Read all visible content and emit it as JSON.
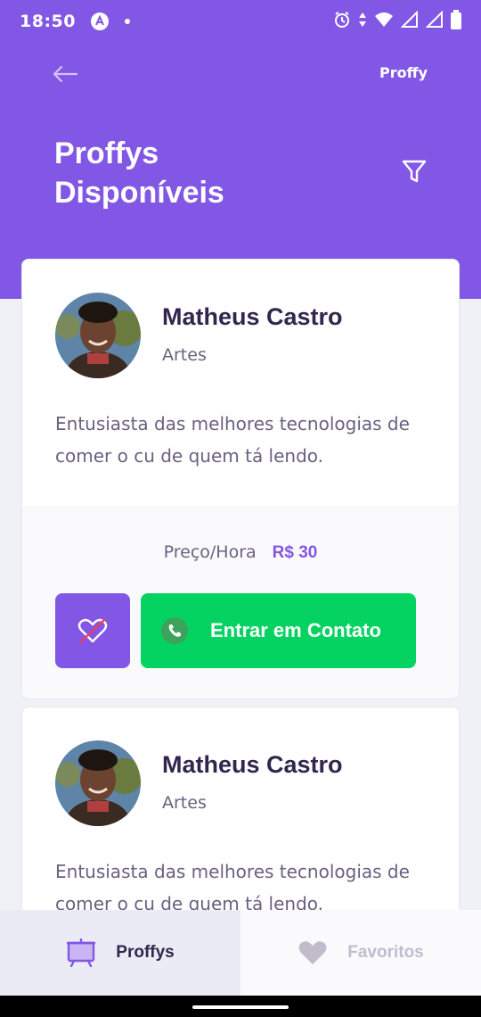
{
  "status_bar": {
    "time": "18:50",
    "icons": [
      "app-notification-icon",
      "dot-icon",
      "alarm-icon",
      "data-arrows-icon",
      "wifi-icon",
      "signal-icon",
      "signal-icon",
      "battery-icon"
    ]
  },
  "header": {
    "brand": "Proffy",
    "title_line1": "Proffys",
    "title_line2": "Disponíveis",
    "back_icon": "arrow-left-icon",
    "filter_icon": "filter-icon"
  },
  "teachers": [
    {
      "name": "Matheus Castro",
      "subject": "Artes",
      "bio": "Entusiasta das melhores tecnologias de comer o cu de quem tá lendo.",
      "price_label": "Preço/Hora",
      "price_value": "R$ 30",
      "contact_label": "Entrar em Contato"
    },
    {
      "name": "Matheus Castro",
      "subject": "Artes",
      "bio": "Entusiasta das melhores tecnologias de comer o cu de quem tá lendo."
    }
  ],
  "tabs": [
    {
      "label": "Proffys",
      "icon": "easel-icon",
      "active": true
    },
    {
      "label": "Favoritos",
      "icon": "heart-icon",
      "active": false
    }
  ],
  "colors": {
    "primary": "#8257E5",
    "secondary": "#04D361",
    "title": "#32264D",
    "text": "#6A6180"
  }
}
